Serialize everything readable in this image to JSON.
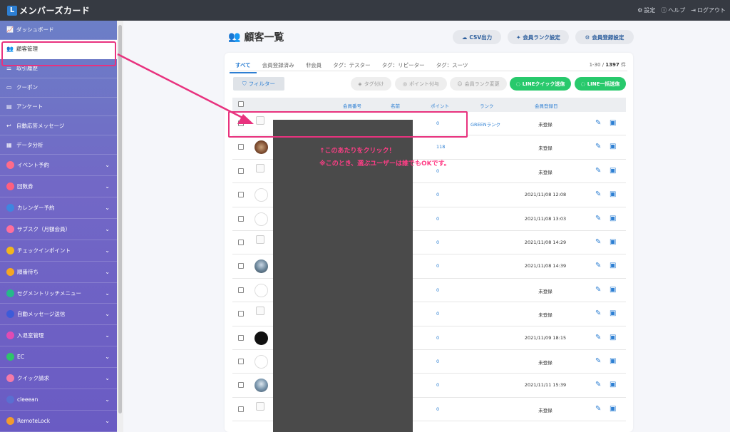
{
  "app": {
    "logo_letter": "L",
    "title": "メンバーズカード"
  },
  "topbar": {
    "settings": "設定",
    "help": "ヘルプ",
    "logout": "ログアウト"
  },
  "sidebar": {
    "items": [
      {
        "label": "ダッシュボード",
        "icon": "chart-icon"
      },
      {
        "label": "顧客管理",
        "icon": "users-icon",
        "active": true
      },
      {
        "label": "取引履歴",
        "icon": "list-icon"
      },
      {
        "label": "クーポン",
        "icon": "ticket-icon"
      },
      {
        "label": "アンケート",
        "icon": "survey-icon"
      },
      {
        "label": "自動応答メッセージ",
        "icon": "reply-icon"
      },
      {
        "label": "データ分析",
        "icon": "analysis-icon"
      }
    ],
    "groups": [
      {
        "label": "イベント予約",
        "color": "#ff6b8a"
      },
      {
        "label": "回数券",
        "color": "#ff5f7e"
      },
      {
        "label": "カレンダー予約",
        "color": "#3f86e0"
      },
      {
        "label": "サブスク（月額会員）",
        "color": "#ff6f9c"
      },
      {
        "label": "チェックインポイント",
        "color": "#f2b51d"
      },
      {
        "label": "順番待ち",
        "color": "#f5a623"
      },
      {
        "label": "セグメントリッチメニュー",
        "color": "#25b98a"
      },
      {
        "label": "自動メッセージ送信",
        "color": "#3d5bd9"
      },
      {
        "label": "入退室管理",
        "color": "#e14bb3"
      },
      {
        "label": "EC",
        "color": "#2fc46b"
      },
      {
        "label": "クイック請求",
        "color": "#f47aa8"
      },
      {
        "label": "cleeean",
        "color": "#5a6fd1"
      },
      {
        "label": "RemoteLock",
        "color": "#f29b2e"
      }
    ]
  },
  "page": {
    "title": "顧客一覧"
  },
  "header_buttons": {
    "csv": "CSV出力",
    "rank_settings": "会員ランク設定",
    "registration_settings": "会員登録設定"
  },
  "tabs": [
    "すべて",
    "会員登録済み",
    "非会員",
    "タグ：テスター",
    "タグ：リピーター",
    "タグ：スーツ"
  ],
  "count": {
    "range": "1-30 / ",
    "total": "1397",
    "unit": " 件"
  },
  "filter_label": "フィルター",
  "actions": {
    "tag": "タグ付け",
    "point": "ポイント付与",
    "rank_change": "会員ランク変更",
    "line_quick": "LINEクイック送信",
    "line_bulk": "LINE一括送信"
  },
  "table": {
    "headers": {
      "member_no": "会員番号",
      "name": "名前",
      "points": "ポイント",
      "rank": "ランク",
      "registered": "会員登録日"
    },
    "rows": [
      {
        "avatar": "broken",
        "points": "0",
        "rank": "GREENランク",
        "registered": "未登録"
      },
      {
        "avatar": "photo1",
        "points": "118",
        "rank": "",
        "registered": "未登録"
      },
      {
        "avatar": "broken",
        "points": "0",
        "rank": "",
        "registered": "未登録"
      },
      {
        "avatar": "circle",
        "points": "0",
        "rank": "",
        "registered": "2021/11/08 12:08"
      },
      {
        "avatar": "circle",
        "points": "0",
        "rank": "",
        "registered": "2021/11/08 13:03"
      },
      {
        "avatar": "broken",
        "points": "0",
        "rank": "",
        "registered": "2021/11/08 14:29"
      },
      {
        "avatar": "photo2",
        "points": "0",
        "rank": "",
        "registered": "2021/11/08 14:39"
      },
      {
        "avatar": "circle",
        "points": "0",
        "rank": "",
        "registered": "未登録"
      },
      {
        "avatar": "broken",
        "points": "0",
        "rank": "",
        "registered": "未登録"
      },
      {
        "avatar": "black",
        "points": "0",
        "rank": "",
        "registered": "2021/11/09 18:15"
      },
      {
        "avatar": "circle",
        "points": "0",
        "rank": "",
        "registered": "未登録"
      },
      {
        "avatar": "photo3",
        "points": "0",
        "rank": "",
        "registered": "2021/11/11 15:39"
      },
      {
        "avatar": "broken",
        "points": "0",
        "rank": "",
        "registered": "未登録"
      }
    ]
  },
  "annotation": {
    "line1": "↑このあたりをクリック！",
    "line2": "※このとき、選ぶユーザーは誰でもOKです。",
    "color": "#e8327e"
  }
}
